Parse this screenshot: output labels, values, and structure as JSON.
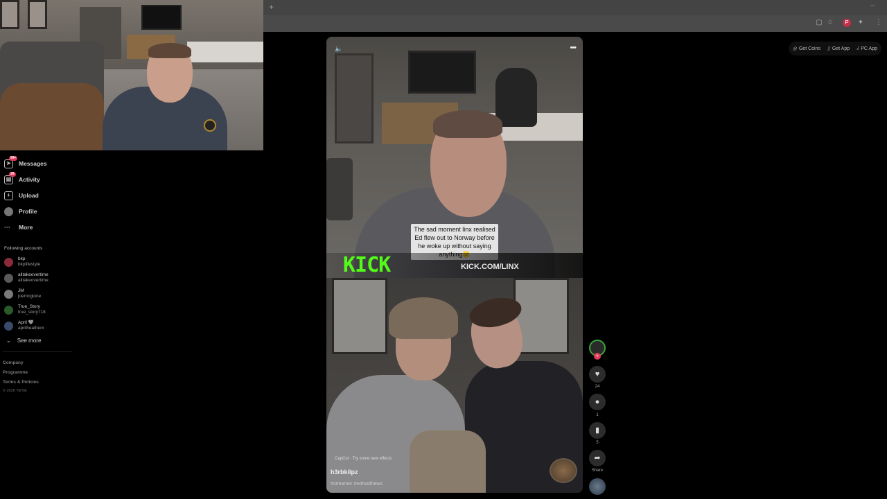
{
  "browser": {
    "new_tab": "+",
    "minimize": "–"
  },
  "get_bar": {
    "coins": "Get Coins",
    "app": "Get App",
    "pc_app": "PC App"
  },
  "sidebar": {
    "nav": [
      {
        "label": "Messages",
        "badge": "99+",
        "icon": "paper-plane-icon"
      },
      {
        "label": "Activity",
        "badge": "28",
        "icon": "inbox-icon"
      },
      {
        "label": "Upload",
        "icon": "plus-square-icon"
      },
      {
        "label": "Profile",
        "icon": "avatar"
      },
      {
        "label": "More",
        "icon": "dots-icon"
      }
    ],
    "following_title": "Following accounts",
    "accounts": [
      {
        "name": "bkp",
        "handle": "bkplifestyle",
        "color": "#8a2a3a"
      },
      {
        "name": "alltakeovertime",
        "handle": "alltakeovertime",
        "color": "#5a5a5a"
      },
      {
        "name": "JM",
        "handle": "joemcglone",
        "color": "#7a7a7a"
      },
      {
        "name": "True_Story",
        "handle": "true_story718",
        "color": "#2a5a2a"
      },
      {
        "name": "April 🩶",
        "handle": "aprilheatherx",
        "color": "#3a4a6a"
      }
    ],
    "see_more": "See more",
    "footer": [
      "Company",
      "Programme",
      "Terms & Policies"
    ],
    "copyright": "© 2026 TikTok"
  },
  "video": {
    "caption": "The sad moment linx realised Ed flew out to Norway before he woke up without saying anything😕",
    "kick_logo": "KICK",
    "kick_url": "KICK.COM/LINX",
    "capcut": "CapCut · Try some new effects",
    "author": "h3rbkilpz",
    "hashtags": "#streamer #edmatthews"
  },
  "actions": {
    "likes": "24",
    "comments": "1",
    "saves": "5",
    "share": "Share"
  }
}
